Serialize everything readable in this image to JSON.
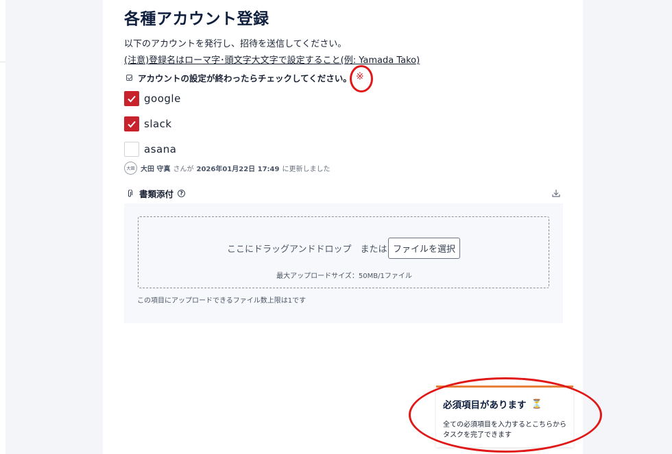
{
  "page": {
    "title": "各種アカウント登録",
    "description": "以下のアカウントを発行し、招待を送信してください。",
    "note": "(注意)登録名はローマ字･頭文字大文字で設定すること(例: Yamada Tako)"
  },
  "checklist": {
    "label": "アカウントの設定が終わったらチェックしてください。",
    "required_mark": "※",
    "items": [
      {
        "label": "google",
        "checked": true
      },
      {
        "label": "slack",
        "checked": true
      },
      {
        "label": "asana",
        "checked": false
      }
    ]
  },
  "updated": {
    "avatar_text": "大田",
    "name": "大田 守真",
    "suffix_san": "さんが",
    "date": "2026年01月22日 17:49",
    "suffix": "に更新しました"
  },
  "attachment": {
    "label": "書類添付",
    "help_icon": "help-circle-icon",
    "drop_text": "ここにドラッグアンドドロップ　または",
    "select_button": "ファイルを選択",
    "max_size": "最大アップロードサイズ：50MB/1ファイル",
    "limit_text": "この項目にアップロードできるファイル数上限は1です"
  },
  "toast": {
    "title": "必須項目があります",
    "icon": "⏳",
    "body": "全ての必須項目を入力するとこちらからタスクを完了できます"
  },
  "colors": {
    "accent_red": "#c8232c",
    "toast_accent": "#e8803a",
    "annotation": "#e01818"
  }
}
